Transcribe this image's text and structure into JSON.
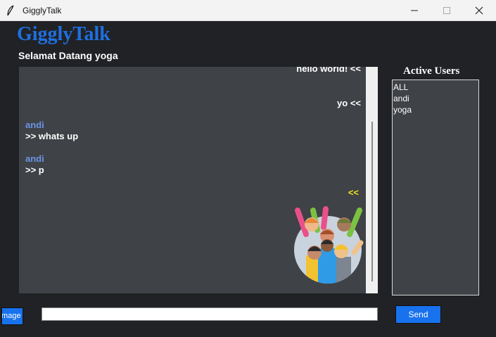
{
  "window": {
    "title": "GigglyTalk"
  },
  "header": {
    "app_title": "GigglyTalk",
    "welcome": "Selamat Datang yoga"
  },
  "chat": {
    "own_messages": [
      "hello world! <<",
      "yo <<"
    ],
    "incoming": [
      {
        "sender": "andi",
        "body": ">> whats up"
      },
      {
        "sender": "andi",
        "body": ">> p"
      }
    ],
    "sticker_marker": "<<"
  },
  "users": {
    "title": "Active Users",
    "list": [
      "ALL",
      "andi",
      "yoga"
    ]
  },
  "controls": {
    "image_button": "Image",
    "message_value": "",
    "send_button": "Send"
  },
  "colors": {
    "accent": "#1872ee",
    "title_blue": "#1f6fe0",
    "sender_blue": "#6b94e6",
    "marker_yellow": "#f0e020",
    "background": "#202225",
    "panel": "#3f4246"
  }
}
